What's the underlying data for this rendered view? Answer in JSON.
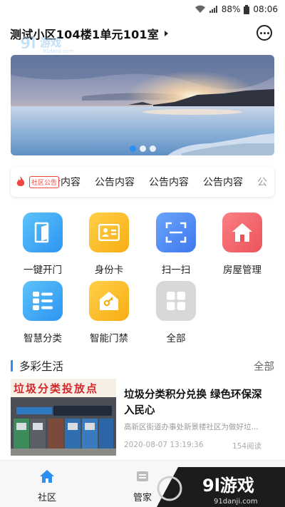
{
  "status_bar": {
    "battery": "88%",
    "time": "08:06"
  },
  "header": {
    "title": "测试小区104楼1单元101室"
  },
  "notice": {
    "tag": "社区公告",
    "items": [
      "告内容",
      "公告内容",
      "公告内容",
      "公告内容",
      "公"
    ]
  },
  "grid": [
    {
      "label": "一键开门",
      "icon": "door-icon",
      "color": "#3fa7f5"
    },
    {
      "label": "身份卡",
      "icon": "id-card-icon",
      "color": "#fcbf1e"
    },
    {
      "label": "扫一扫",
      "icon": "scan-icon",
      "color": "#4d8cf5"
    },
    {
      "label": "房屋管理",
      "icon": "house-icon",
      "color": "#f2646b"
    },
    {
      "label": "智慧分类",
      "icon": "list-icon",
      "color": "#3fa7f5"
    },
    {
      "label": "智能门禁",
      "icon": "key-house-icon",
      "color": "#fcbf1e"
    },
    {
      "label": "全部",
      "icon": "apps-icon",
      "color": "#d8d8d8"
    }
  ],
  "section": {
    "title": "多彩生活",
    "more": "全部"
  },
  "news": {
    "image_banner": "垃圾分类投放点",
    "title": "垃圾分类积分兑换 绿色环保深入民心",
    "summary": "高新区街道办事处新景楼社区为做好垃...",
    "date": "2020-08-07 13:19:36",
    "reads": "154阅读"
  },
  "tabbar": [
    {
      "label": "社区",
      "icon": "home-icon",
      "active": true
    },
    {
      "label": "管家",
      "icon": "butler-icon",
      "active": false
    }
  ],
  "watermark": {
    "brand": "9l游戏",
    "site": "91danji.com",
    "small_site": "91danji.com"
  },
  "colors": {
    "accent": "#2b8ef0",
    "notice_red": "#f0463c"
  }
}
